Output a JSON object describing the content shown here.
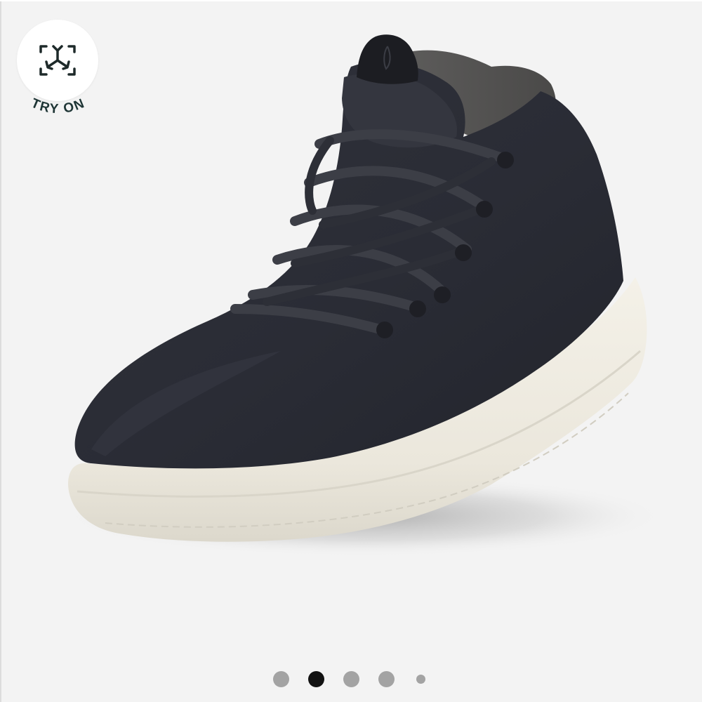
{
  "try_on": {
    "label": "TRY ON",
    "icon": "ar-cube-icon"
  },
  "product": {
    "image_icon": "shoe-product-image",
    "upper_color": "#2b2d36",
    "sole_color": "#efece3",
    "background_color": "#f3f3f3"
  },
  "carousel": {
    "total": 5,
    "active_index": 2,
    "active_color": "#121212",
    "inactive_color": "#a3a3a3"
  }
}
